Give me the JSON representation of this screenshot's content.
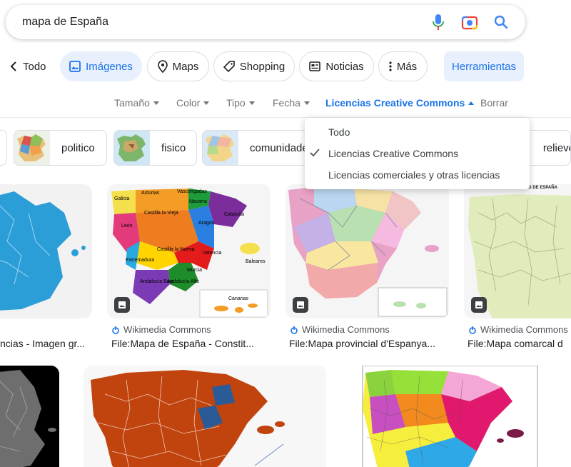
{
  "search": {
    "query": "mapa de España"
  },
  "tabs": {
    "back_label": "Todo",
    "items": [
      {
        "label": "Imágenes",
        "icon": "image-icon",
        "active": true
      },
      {
        "label": "Maps",
        "icon": "map-pin-icon"
      },
      {
        "label": "Shopping",
        "icon": "tag-icon"
      },
      {
        "label": "Noticias",
        "icon": "news-icon"
      },
      {
        "label": "Más",
        "icon": "more-vert-icon"
      }
    ],
    "tools_label": "Herramientas"
  },
  "filters": {
    "size": "Tamaño",
    "color": "Color",
    "type": "Tipo",
    "date": "Fecha",
    "license": "Licencias Creative Commons",
    "clear": "Borrar"
  },
  "suggestions": [
    "politico",
    "fisico",
    "comunidades",
    "relieve"
  ],
  "license_menu": {
    "items": [
      "Todo",
      "Licencias Creative Commons",
      "Licencias comerciales y otras licencias"
    ],
    "selected_index": 1
  },
  "results": [
    {
      "source": "",
      "title": "ncias - Imagen gr..."
    },
    {
      "source": "Wikimedia Commons",
      "title": "File:Mapa de España - Constit..."
    },
    {
      "source": "Wikimedia Commons",
      "title": "File:Mapa provincial d'Espanya..."
    },
    {
      "source": "Wikimedia Commons",
      "title": "File:Mapa comarcal d"
    }
  ],
  "map_labels": {
    "galicia": "Galicia",
    "asturias": "Asturias",
    "vascongadas": "Vascongadas",
    "navarra": "Navarra",
    "cataluna": "Cataluña",
    "aragon": "Aragón",
    "castilla_vieja": "Castilla la Vieja",
    "leon": "León",
    "castilla_nueva": "Castilla la Nueva",
    "extremadura": "Extremadura",
    "valencia": "Valencia",
    "murcia": "Murcia",
    "baleares": "Baleares",
    "andalucia_alta": "Andalucía Alta",
    "andalucia_baja": "Andalucía Baja",
    "canarias": "Canarias",
    "comarcas_header": "CAS DE ESPAÑA"
  },
  "colors": {
    "accent": "#1a73e8",
    "active_bg": "#e8f0fe"
  }
}
